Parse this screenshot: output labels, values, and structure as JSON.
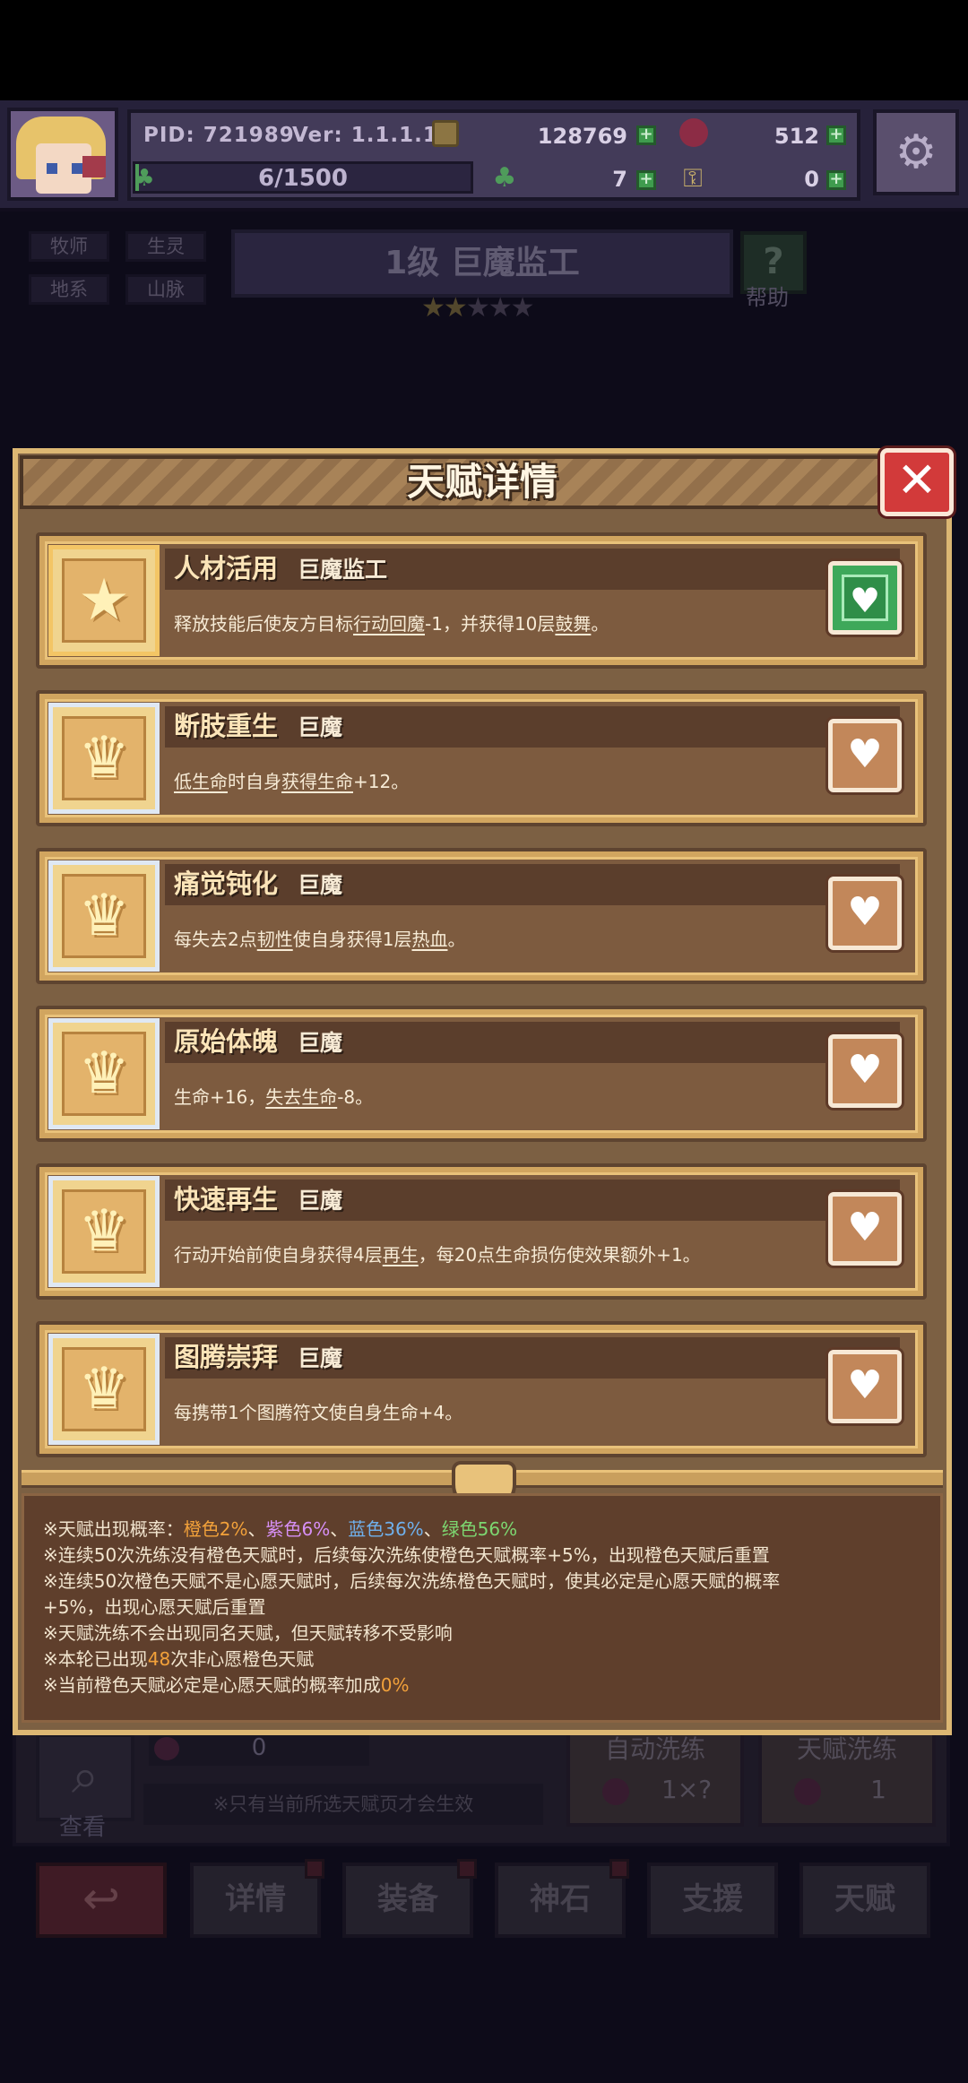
{
  "hud": {
    "pid": "PID: 721989",
    "version": "Ver: 1.1.1.13",
    "gold": "128769",
    "gems": "512",
    "energy": "6/1500",
    "clover": "7",
    "keys": "0"
  },
  "class_tags": [
    "牧师",
    "生灵",
    "地系",
    "山脉"
  ],
  "rank": {
    "title": "1级  巨魔监工",
    "help": "帮助",
    "stars_on": 2,
    "stars_total": 5,
    "stars_text": "★★★★★"
  },
  "modal": {
    "title": "天赋详情",
    "close": "✕",
    "talents": [
      {
        "name": "人材活用",
        "race": "巨魔监工",
        "desc_parts": [
          "释放技能后使友方目标",
          "行动回魔",
          "-1，并获得10层",
          "鼓舞",
          "。"
        ],
        "underlined": [
          1,
          3
        ],
        "favorited": true,
        "tier": "gold",
        "glyph": "★"
      },
      {
        "name": "断肢重生",
        "race": "巨魔",
        "desc_parts": [
          "",
          "低生命",
          "时自身",
          "获得生命",
          "+12。"
        ],
        "underlined": [
          1,
          3
        ],
        "favorited": false,
        "tier": "silver",
        "glyph": "♛"
      },
      {
        "name": "痛觉钝化",
        "race": "巨魔",
        "desc_parts": [
          "每失去2点",
          "韧性",
          "使自身获得1层",
          "热血",
          "。"
        ],
        "underlined": [
          1,
          3
        ],
        "favorited": false,
        "tier": "silver",
        "glyph": "♛"
      },
      {
        "name": "原始体魄",
        "race": "巨魔",
        "desc_parts": [
          "生命+16，",
          "失去生命",
          "-8。",
          "",
          ""
        ],
        "underlined": [
          1
        ],
        "favorited": false,
        "tier": "silver",
        "glyph": "♛"
      },
      {
        "name": "快速再生",
        "race": "巨魔",
        "desc_parts": [
          "行动开始前使自身获得4层",
          "再生",
          "，每20点生命损伤使效果额外+1。",
          "",
          ""
        ],
        "underlined": [
          1
        ],
        "favorited": false,
        "tier": "silver",
        "glyph": "♛"
      },
      {
        "name": "图腾崇拜",
        "race": "巨魔",
        "desc_parts": [
          "每携带1个图腾符文使自身生命+4。",
          "",
          "",
          "",
          ""
        ],
        "underlined": [],
        "favorited": false,
        "tier": "silver",
        "glyph": "♛"
      }
    ],
    "heart_icon": "♥",
    "notes": {
      "line1_prefix": "※天赋出现概率：",
      "orange": "橙色2%",
      "sep": "、",
      "purple": "紫色6%",
      "blue": "蓝色36%",
      "green": "绿色56%",
      "line2": "※连续50次洗练没有橙色天赋时，后续每次洗练使橙色天赋概率+5%，出现橙色天赋后重置",
      "line3": "※连续50次橙色天赋不是心愿天赋时，后续每次洗练橙色天赋时，使其必定是心愿天赋的概率",
      "line4": "+5%，出现心愿天赋后重置",
      "line5": "※天赋洗练不会出现同名天赋，但天赋转移不受影响",
      "line6_prefix": "※本轮已出现",
      "line6_value": "48",
      "line6_suffix": "次非心愿橙色天赋",
      "line7_prefix": "※当前橙色天赋必定是心愿天赋的概率加成",
      "line7_value": "0%"
    }
  },
  "background": {
    "pot_count": "0",
    "view_label": "查看",
    "hint": "※只有当前所选天赋页才会生效",
    "auto_label": "自动洗练",
    "auto_value": "1×?",
    "refine_label": "天赋洗练",
    "refine_value": "1",
    "tabs": [
      "详情",
      "装备",
      "神石",
      "支援",
      "天赋"
    ],
    "back_icon": "↩",
    "view_icon": "⌕"
  },
  "colors": {
    "orange": "#f2a13a",
    "purple": "#d68ff5",
    "blue": "#6fb0ec",
    "green": "#7dd771",
    "modal_frame": "#dcb773",
    "close_red": "#d23a3a",
    "fav_green": "#3ea85a"
  }
}
